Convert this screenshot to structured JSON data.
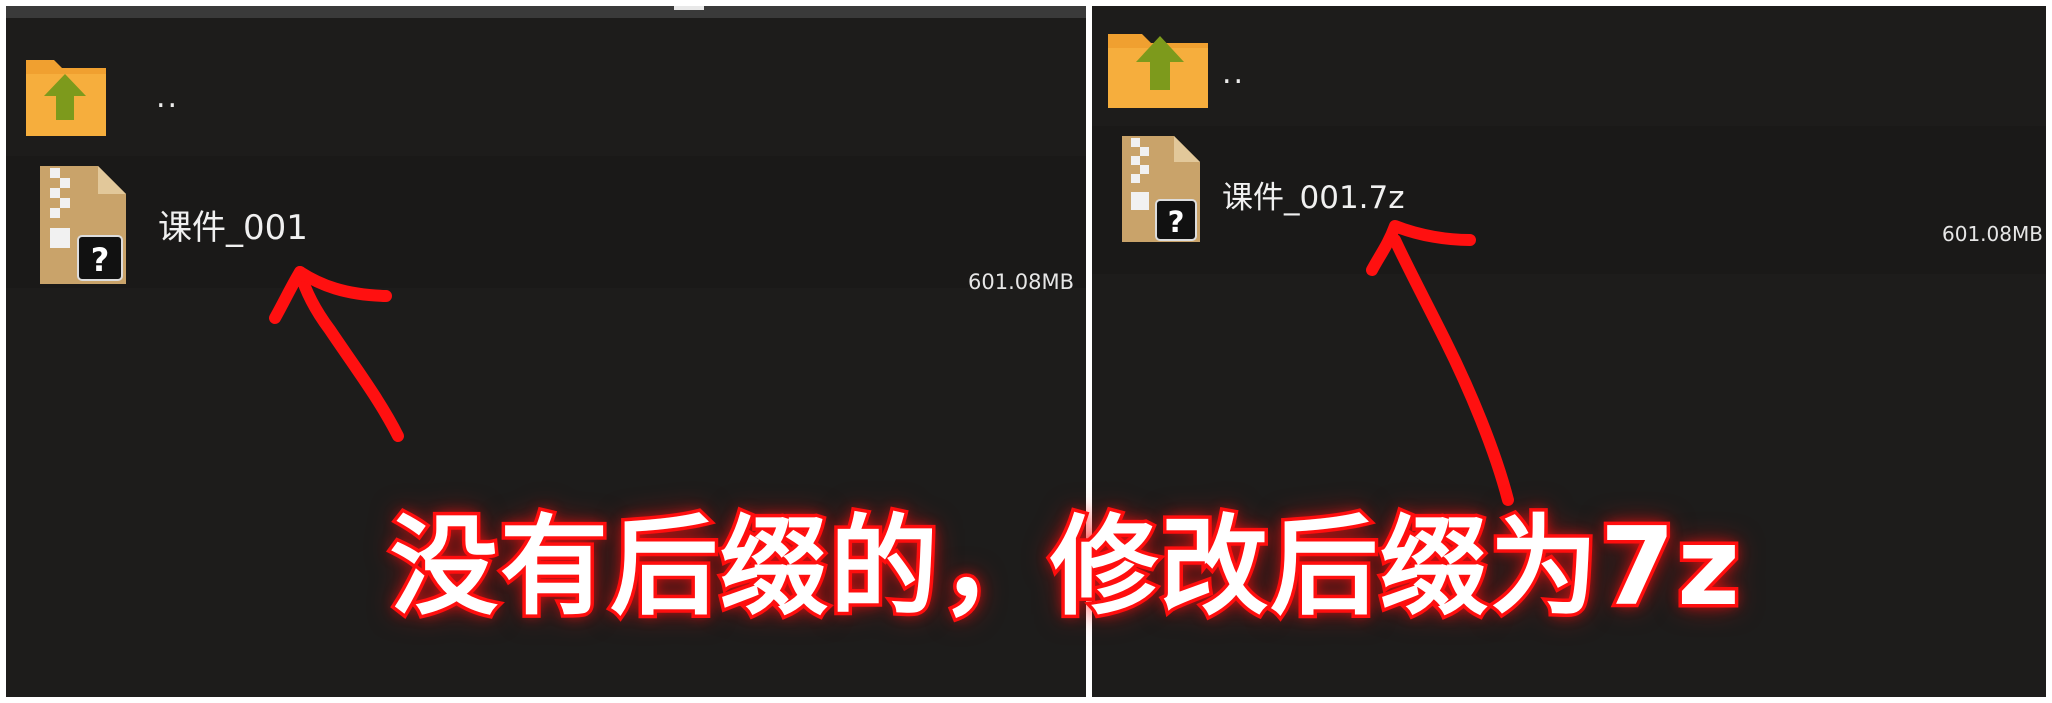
{
  "colors": {
    "panel_bg": "#1d1c1b",
    "folder": "#f3a535",
    "up_arrow": "#7d9a1c",
    "archive": "#c9a36a",
    "annotation_red": "#ff1010"
  },
  "left_panel": {
    "parent_label": "..",
    "file": {
      "name": "课件_001",
      "size": "601.08MB",
      "icon": "unknown-archive-icon"
    }
  },
  "right_panel": {
    "parent_label": "..",
    "file": {
      "name": "课件_001.7z",
      "size": "601.08MB",
      "icon": "unknown-archive-icon"
    }
  },
  "annotation": {
    "caption": "没有后缀的，修改后缀为7z"
  }
}
